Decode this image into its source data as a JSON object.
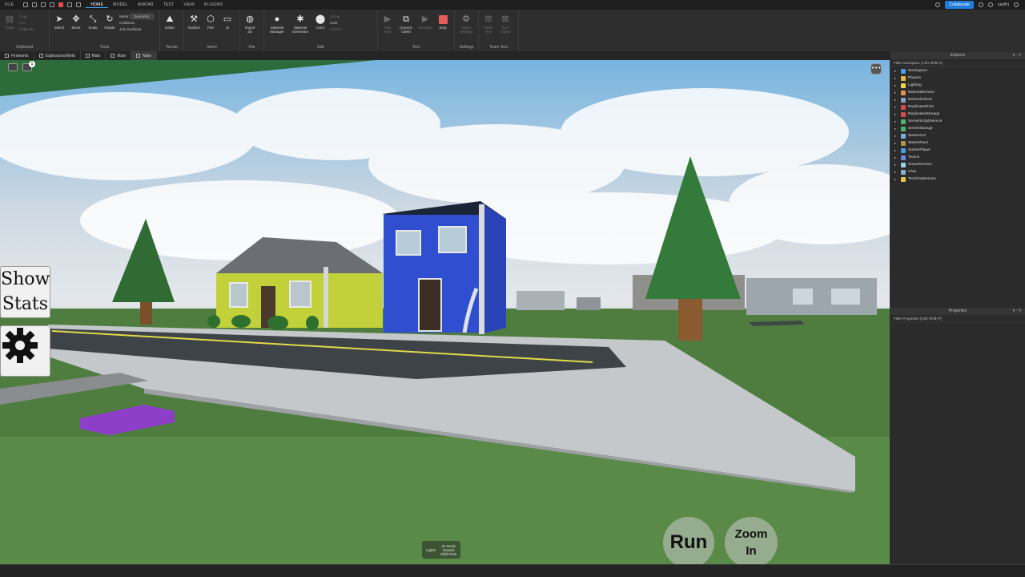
{
  "menubar": {
    "menus": [
      "FILE",
      "HOME",
      "MODEL",
      "AVATAR",
      "TEST",
      "VIEW",
      "PLUGINS"
    ],
    "active_menu": "HOME",
    "collaborate_label": "Collaborate",
    "user_name": "sadfrj"
  },
  "ribbon": {
    "clipboard": {
      "paste": "Paste",
      "copy": "Copy",
      "cut": "Cut",
      "duplicate": "Duplicate",
      "group_name": "Clipboard"
    },
    "tools": {
      "select": "Select",
      "move": "Move",
      "scale": "Scale",
      "rotate": "Rotate",
      "mode_label": "Mode:",
      "mode_value": "Geometric",
      "collisions": "Collisions",
      "join_surfaces": "Join Surfaces",
      "group_name": "Tools"
    },
    "terrain": {
      "editor": "Editor",
      "group_name": "Terrain"
    },
    "insert": {
      "toolbox": "Toolbox",
      "part": "Part",
      "ui": "UI",
      "group_name": "Insert"
    },
    "file": {
      "import3d": "Import 3D",
      "group_name": "File"
    },
    "edit": {
      "material_manager": "Material Manager",
      "material_generator": "Material Generator",
      "color": "Color",
      "group": "Group",
      "lock": "Lock",
      "anchor": "Anchor",
      "group_name": "Edit"
    },
    "test": {
      "play_here": "Play Here",
      "current_client": "Current: Client",
      "simulate": "Simulate",
      "stop": "Stop",
      "group_name": "Test"
    },
    "settings": {
      "game_settings": "Game Settings",
      "group_name": "Settings"
    },
    "team_test": {
      "team_test": "Team Test",
      "exit_game": "Exit Game",
      "group_name": "Team Test"
    }
  },
  "tabs": [
    {
      "label": "Fireworks"
    },
    {
      "label": "Explosions/Weld"
    },
    {
      "label": "Main"
    },
    {
      "label": "Main"
    },
    {
      "label": "Main"
    }
  ],
  "viewport": {
    "show_stats_line1": "Show",
    "show_stats_line2": "Stats",
    "run_label": "Run",
    "zoom_line1": "Zoom",
    "zoom_line2": "In",
    "notification_count": "1",
    "hud_left": "Lights",
    "hud_mid_line1": "32 Studs",
    "hud_mid_line2": "Swatch",
    "hud_mid_line3": "Shift Pack"
  },
  "explorer": {
    "title": "Explorer",
    "filter_placeholder": "Filter workspace (Ctrl+Shift+X)",
    "items": [
      {
        "label": "Workspace",
        "color": "#4a9be8"
      },
      {
        "label": "Players",
        "color": "#e8b44a"
      },
      {
        "label": "Lighting",
        "color": "#f2d14a"
      },
      {
        "label": "MaterialService",
        "color": "#e8904a"
      },
      {
        "label": "NetworkClient",
        "color": "#8aa0c8"
      },
      {
        "label": "ReplicatedFirst",
        "color": "#d84a4a"
      },
      {
        "label": "ReplicatedStorage",
        "color": "#d84a4a"
      },
      {
        "label": "ServerScriptService",
        "color": "#4ab56a"
      },
      {
        "label": "ServerStorage",
        "color": "#4ab56a"
      },
      {
        "label": "StarterGui",
        "color": "#7ab0e0"
      },
      {
        "label": "StarterPack",
        "color": "#b0904a"
      },
      {
        "label": "StarterPlayer",
        "color": "#4a9be8"
      },
      {
        "label": "Teams",
        "color": "#6a8ad8"
      },
      {
        "label": "SoundService",
        "color": "#9ad0e8"
      },
      {
        "label": "Chat",
        "color": "#8ab0d8"
      },
      {
        "label": "TextChatService",
        "color": "#e8c04a"
      }
    ]
  },
  "properties": {
    "title": "Properties",
    "filter_placeholder": "Filter Properties (Ctrl+Shift+P)"
  }
}
